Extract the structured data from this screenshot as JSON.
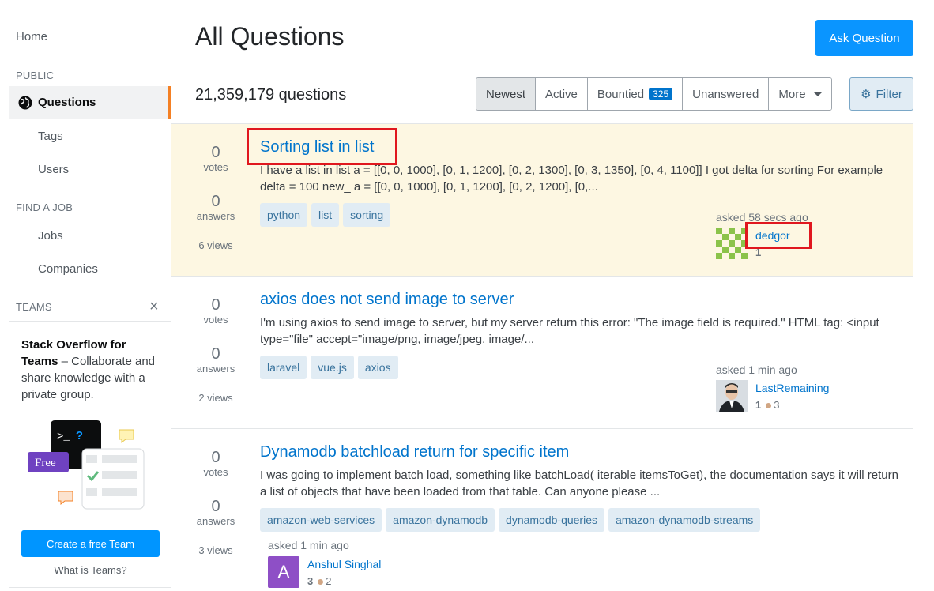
{
  "sidebar": {
    "home": "Home",
    "public_label": "PUBLIC",
    "questions": "Questions",
    "tags": "Tags",
    "users": "Users",
    "find_job_label": "FIND A JOB",
    "jobs": "Jobs",
    "companies": "Companies",
    "teams_label": "TEAMS",
    "teams_close": "×",
    "teams_promo": {
      "title": "Stack Overflow for Teams",
      "dash": " – ",
      "desc": "Collaborate and share knowledge with a private group.",
      "free_badge": "Free",
      "terminal": ">_",
      "terminal_q": "?",
      "cta": "Create a free Team",
      "link": "What is Teams?"
    }
  },
  "header": {
    "title": "All Questions",
    "ask_button": "Ask Question",
    "count": "21,359,179 questions"
  },
  "filters": {
    "tabs": [
      {
        "label": "Newest",
        "active": true
      },
      {
        "label": "Active"
      },
      {
        "label": "Bountied",
        "badge": "325"
      },
      {
        "label": "Unanswered"
      },
      {
        "label": "More"
      }
    ],
    "filter_button": "Filter"
  },
  "questions": [
    {
      "votes": "0",
      "votes_label": "votes",
      "answers": "0",
      "answers_label": "answers",
      "views": "6 views",
      "title": "Sorting list in list",
      "excerpt": "I have a list in list a = [[0, 0, 1000], [0, 1, 1200], [0, 2, 1300], [0, 3, 1350], [0, 4, 1100]] I got delta for sorting For example delta = 100 new_ a = [[0, 0, 1000], [0, 1, 1200], [0, 2, 1200], [0,...",
      "tags": [
        "python",
        "list",
        "sorting"
      ],
      "asked": "asked 58 secs ago",
      "user": "dedgor",
      "reputation": "1",
      "bronze": ""
    },
    {
      "votes": "0",
      "votes_label": "votes",
      "answers": "0",
      "answers_label": "answers",
      "views": "2 views",
      "title": "axios does not send image to server",
      "excerpt": "I'm using axios to send image to server, but my server return this error: \"The image field is required.\" HTML tag: <input type=\"file\" accept=\"image/png, image/jpeg, image/...",
      "tags": [
        "laravel",
        "vue.js",
        "axios"
      ],
      "asked": "asked 1 min ago",
      "user": "LastRemaining",
      "reputation": "1",
      "bronze": "3"
    },
    {
      "votes": "0",
      "votes_label": "votes",
      "answers": "0",
      "answers_label": "answers",
      "views": "3 views",
      "title": "Dynamodb batchload return for specific item",
      "excerpt": "I was going to implement batch load, something like batchLoad( iterable itemsToGet), the documentation says it will return a list of objects that have been loaded from that table. Can anyone please ...",
      "tags": [
        "amazon-web-services",
        "amazon-dynamodb",
        "dynamodb-queries",
        "amazon-dynamodb-streams"
      ],
      "asked": "asked 1 min ago",
      "user": "Anshul Singhal",
      "avatar_letter": "A",
      "reputation": "3",
      "bronze": "2"
    }
  ],
  "colors": {
    "accent": "#0a95ff",
    "link": "#0074cc",
    "highlight_row": "#fdf7e2",
    "annotation_box": "#e0171e"
  }
}
